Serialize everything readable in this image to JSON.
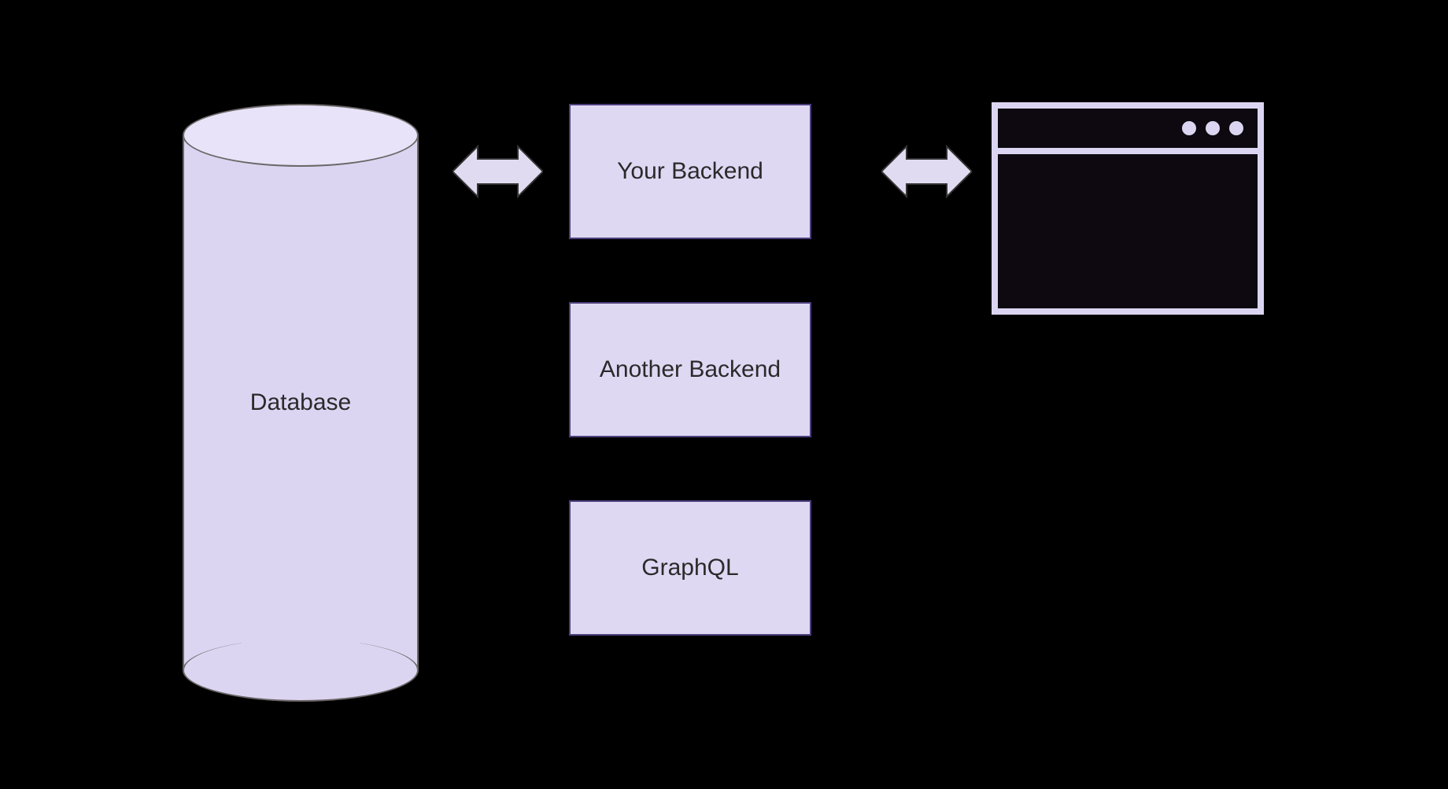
{
  "diagram": {
    "nodes": {
      "database": {
        "label": "Database",
        "type": "cylinder"
      },
      "backends": [
        {
          "label": "Your Backend",
          "type": "box"
        },
        {
          "label": "Another Backend",
          "type": "box"
        },
        {
          "label": "GraphQL",
          "type": "box"
        }
      ],
      "client": {
        "type": "browser-window"
      }
    },
    "arrows": [
      {
        "from": "database",
        "to": "backends[0]",
        "bidirectional": true
      },
      {
        "from": "backends[0]",
        "to": "client",
        "bidirectional": true
      }
    ],
    "colors": {
      "fill": "#dfd8f3",
      "stroke": "#4e3f7e",
      "arrowFill": "#e1dbf2",
      "arrowStroke": "#333333",
      "background": "#000000",
      "text": "#2a2a2a"
    }
  }
}
